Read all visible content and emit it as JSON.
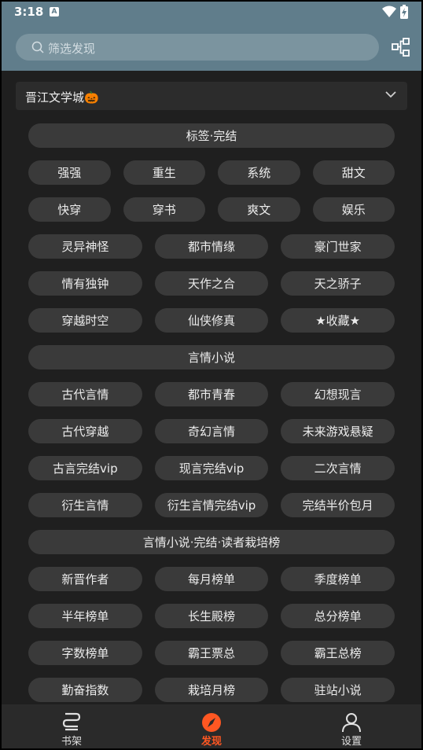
{
  "status": {
    "time": "3:18"
  },
  "search": {
    "placeholder": "筛选发现"
  },
  "source": {
    "label": "晋江文学城🎃"
  },
  "sections": [
    {
      "header": "标签·完结",
      "rows": [
        [
          "强强",
          "重生",
          "系统",
          "甜文"
        ],
        [
          "快穿",
          "穿书",
          "爽文",
          "娱乐"
        ],
        [
          "灵异神怪",
          "都市情缘",
          "豪门世家"
        ],
        [
          "情有独钟",
          "天作之合",
          "天之骄子"
        ],
        [
          "穿越时空",
          "仙侠修真",
          "★收藏★"
        ]
      ]
    },
    {
      "header": "言情小说",
      "rows": [
        [
          "古代言情",
          "都市青春",
          "幻想现言"
        ],
        [
          "古代穿越",
          "奇幻言情",
          "未来游戏悬疑"
        ],
        [
          "古言完结vip",
          "现言完结vip",
          "二次言情"
        ],
        [
          "衍生言情",
          "衍生言情完结vip",
          "完结半价包月"
        ]
      ]
    },
    {
      "header": "言情小说·完结·读者栽培榜",
      "rows": [
        [
          "新晋作者",
          "每月榜单",
          "季度榜单"
        ],
        [
          "半年榜单",
          "长生殿榜",
          "总分榜单"
        ],
        [
          "字数榜单",
          "霸王票总",
          "霸王总榜"
        ],
        [
          "勤奋指数",
          "栽培月榜",
          "驻站小说"
        ]
      ]
    }
  ],
  "nav": [
    {
      "label": "书架",
      "icon": "bookshelf-icon"
    },
    {
      "label": "发现",
      "icon": "compass-icon",
      "active": true
    },
    {
      "label": "设置",
      "icon": "person-icon"
    }
  ],
  "colors": {
    "accent": "#ff5722",
    "header": "#607d8b",
    "chip": "#3a3a3a",
    "background": "#1f1f1f"
  }
}
